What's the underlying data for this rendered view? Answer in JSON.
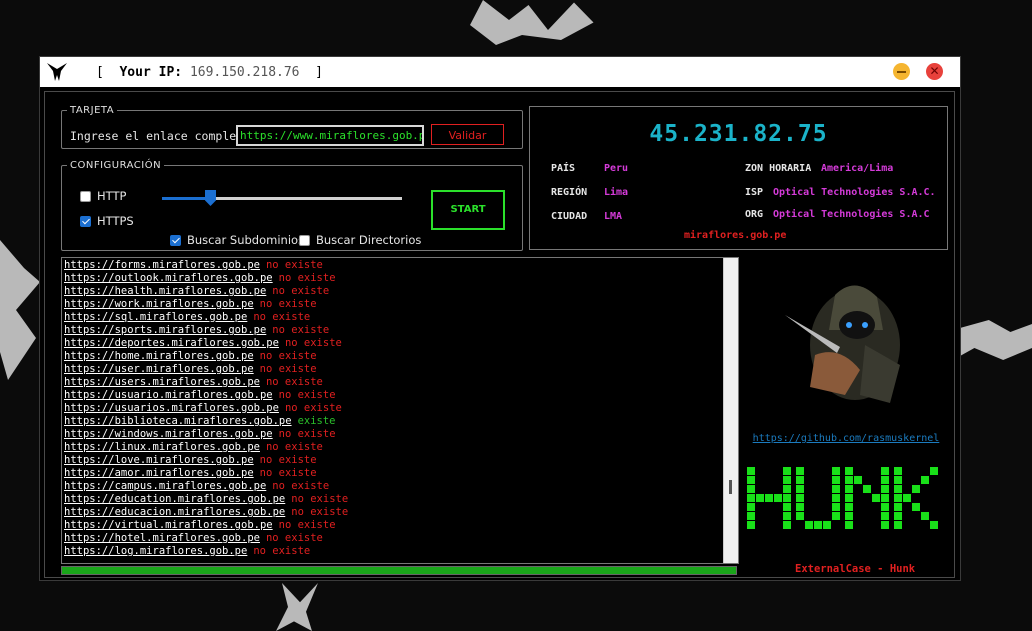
{
  "titlebar": {
    "bracket_open": "[",
    "ip_label": "Your IP:",
    "ip_value": "169.150.218.76",
    "bracket_close": "]",
    "close_glyph": "✕"
  },
  "tarjeta": {
    "legend": "TARJETA",
    "input_label": "Ingrese el enlace completo",
    "url_value": "https://www.miraflores.gob.pe",
    "validate_label": "Validar"
  },
  "config": {
    "legend": "CONFIGURACIÓN",
    "http_label": "HTTP",
    "http_checked": false,
    "https_label": "HTTPS",
    "https_checked": true,
    "subdomains_label": "Buscar Subdominios",
    "subdomains_checked": true,
    "directories_label": "Buscar Directorios",
    "directories_checked": false,
    "slider_value": 0.2,
    "start_label": "START"
  },
  "info": {
    "ip": "45.231.82.75",
    "pais_label": "PAÍS",
    "pais": "Peru",
    "region_label": "REGIÓN",
    "region": "Lima",
    "ciudad_label": "CIUDAD",
    "ciudad": "LMA",
    "zona_label": "ZON HORARIA",
    "zona": "America/Lima",
    "isp_label": "ISP",
    "isp": "Optical Technologies S.A.C.",
    "org_label": "ORG",
    "org": "Optical Technologies S.A.C",
    "domain": "miraflores.gob.pe"
  },
  "results": [
    {
      "url": "https://forms.miraflores.gob.pe",
      "status": "no existe"
    },
    {
      "url": "https://outlook.miraflores.gob.pe",
      "status": "no existe"
    },
    {
      "url": "https://health.miraflores.gob.pe",
      "status": "no existe"
    },
    {
      "url": "https://work.miraflores.gob.pe",
      "status": "no existe"
    },
    {
      "url": "https://sql.miraflores.gob.pe",
      "status": "no existe"
    },
    {
      "url": "https://sports.miraflores.gob.pe",
      "status": "no existe"
    },
    {
      "url": "https://deportes.miraflores.gob.pe",
      "status": "no existe"
    },
    {
      "url": "https://home.miraflores.gob.pe",
      "status": "no existe"
    },
    {
      "url": "https://user.miraflores.gob.pe",
      "status": "no existe"
    },
    {
      "url": "https://users.miraflores.gob.pe",
      "status": "no existe"
    },
    {
      "url": "https://usuario.miraflores.gob.pe",
      "status": "no existe"
    },
    {
      "url": "https://usuarios.miraflores.gob.pe",
      "status": "no existe"
    },
    {
      "url": "https://biblioteca.miraflores.gob.pe",
      "status": "existe"
    },
    {
      "url": "https://windows.miraflores.gob.pe",
      "status": "no existe"
    },
    {
      "url": "https://linux.miraflores.gob.pe",
      "status": "no existe"
    },
    {
      "url": "https://love.miraflores.gob.pe",
      "status": "no existe"
    },
    {
      "url": "https://amor.miraflores.gob.pe",
      "status": "no existe"
    },
    {
      "url": "https://campus.miraflores.gob.pe",
      "status": "no existe"
    },
    {
      "url": "https://education.miraflores.gob.pe",
      "status": "no existe"
    },
    {
      "url": "https://educacion.miraflores.gob.pe",
      "status": "no existe"
    },
    {
      "url": "https://virtual.miraflores.gob.pe",
      "status": "no existe"
    },
    {
      "url": "https://hotel.miraflores.gob.pe",
      "status": "no existe"
    },
    {
      "url": "https://log.miraflores.gob.pe",
      "status": "no existe"
    }
  ],
  "progress": 1.0,
  "side": {
    "github_link": "https://github.com/rasmuskernel",
    "logo_text": "HUNK",
    "footer": "ExternalCase - Hunk"
  },
  "colors": {
    "accent_green": "#2be12b",
    "error_red": "#e02020",
    "ip_cyan": "#1bb3c9",
    "value_magenta": "#d53bd9"
  }
}
